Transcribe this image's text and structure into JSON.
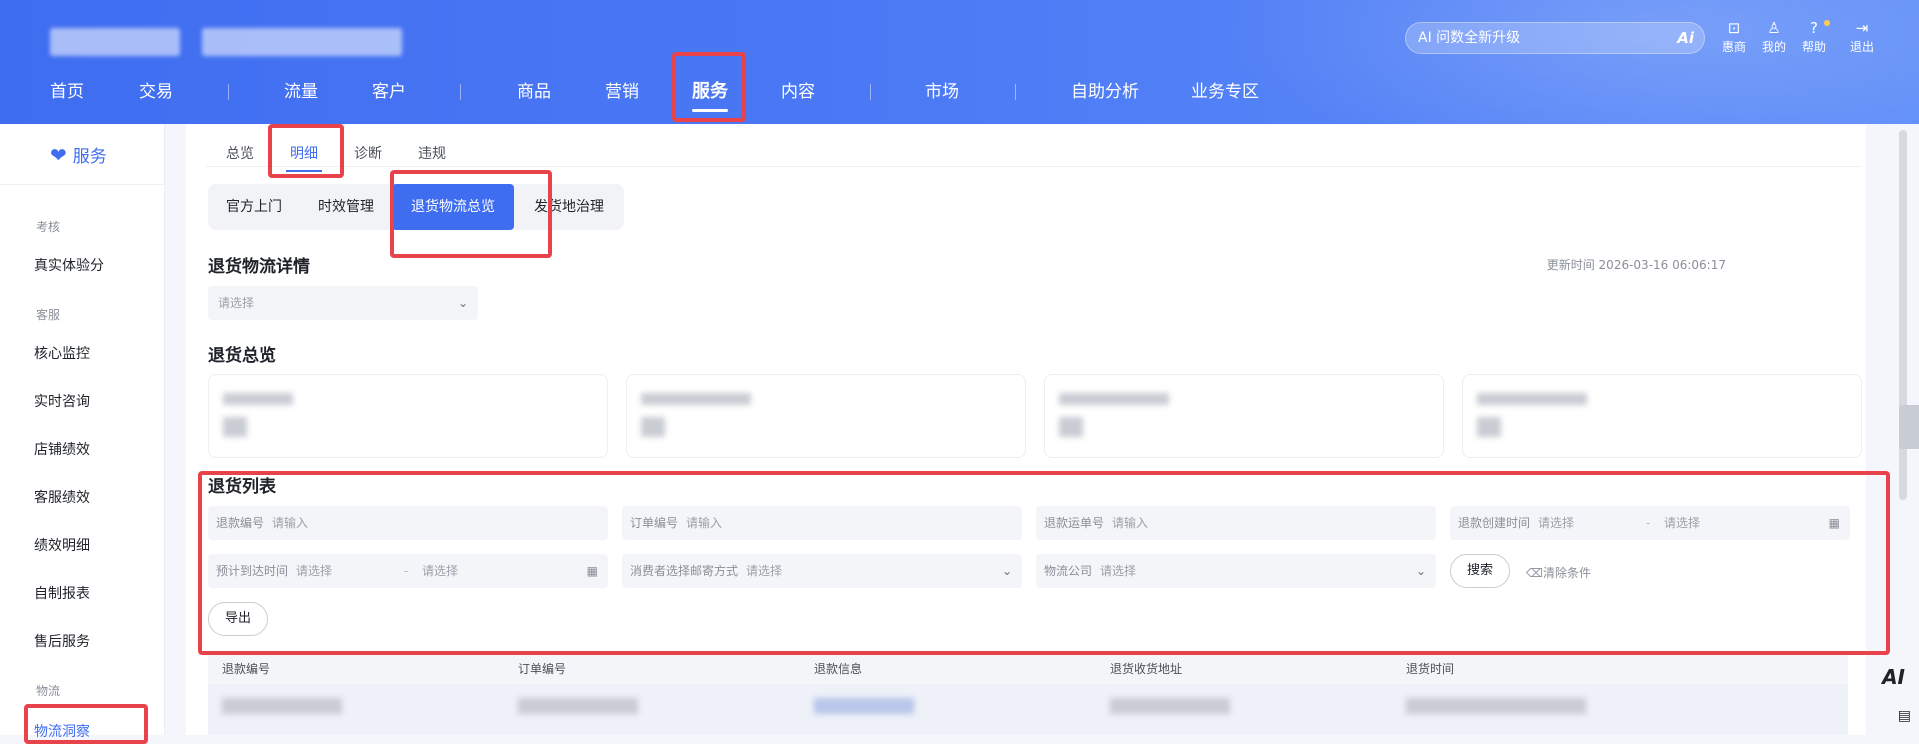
{
  "header": {
    "nav": [
      {
        "label": "首页"
      },
      {
        "label": "交易"
      },
      {
        "label": "流量"
      },
      {
        "label": "客户"
      },
      {
        "label": "商品"
      },
      {
        "label": "营销"
      },
      {
        "label": "服务"
      },
      {
        "label": "内容"
      },
      {
        "label": "市场"
      },
      {
        "label": "自助分析"
      },
      {
        "label": "业务专区"
      }
    ],
    "active_nav": "服务",
    "ai_search_text": "AI 问数全新升级",
    "ai_icon_glyph": "Ai",
    "tools": [
      {
        "label": "惠商",
        "icon": "bag-icon",
        "glyph": "⊡"
      },
      {
        "label": "我的",
        "icon": "user-icon",
        "glyph": "♙"
      },
      {
        "label": "帮助",
        "icon": "help-icon",
        "glyph": "?"
      },
      {
        "label": "退出",
        "icon": "logout-icon",
        "glyph": "⇥"
      }
    ],
    "colors": {
      "brand": "#3f6df0",
      "annotation": "#e8424a"
    }
  },
  "sidebar": {
    "title": "服务",
    "groups": [
      {
        "label": "考核",
        "items": [
          "真实体验分"
        ]
      },
      {
        "label": "客服",
        "items": [
          "核心监控",
          "实时咨询",
          "店铺绩效",
          "客服绩效",
          "绩效明细",
          "自制报表",
          "售后服务"
        ]
      },
      {
        "label": "物流",
        "items": [
          "物流洞察"
        ]
      }
    ],
    "active_item": "物流洞察"
  },
  "main": {
    "tabs": [
      "总览",
      "明细",
      "诊断",
      "违规"
    ],
    "active_tab": "明细",
    "segments": [
      "官方上门",
      "时效管理",
      "退货物流总览",
      "发货地治理"
    ],
    "active_segment": "退货物流总览",
    "detail_title": "退货物流详情",
    "update_time": "更新时间 2026-03-16 06:06:17",
    "detail_select_placeholder": "请选择",
    "overview_title": "退货总览",
    "list_title": "退货列表",
    "filters": {
      "refund_no": {
        "label": "退款编号",
        "placeholder": "请输入"
      },
      "order_no": {
        "label": "订单编号",
        "placeholder": "请输入"
      },
      "return_waybill": {
        "label": "退款运单号",
        "placeholder": "请输入"
      },
      "refund_created": {
        "label": "退款创建时间",
        "start": "请选择",
        "dash": "-",
        "end": "请选择"
      },
      "expected_arrival": {
        "label": "预计到达时间",
        "start": "请选择",
        "dash": "-",
        "end": "请选择"
      },
      "ship_method": {
        "label": "消费者选择邮寄方式",
        "placeholder": "请选择"
      },
      "carrier": {
        "label": "物流公司",
        "placeholder": "请选择"
      }
    },
    "search_button": "搜索",
    "clear_button": "清除条件",
    "export_button": "导出",
    "table_headers": [
      "退款编号",
      "订单编号",
      "退款信息",
      "退货收货地址",
      "退货时间"
    ]
  }
}
